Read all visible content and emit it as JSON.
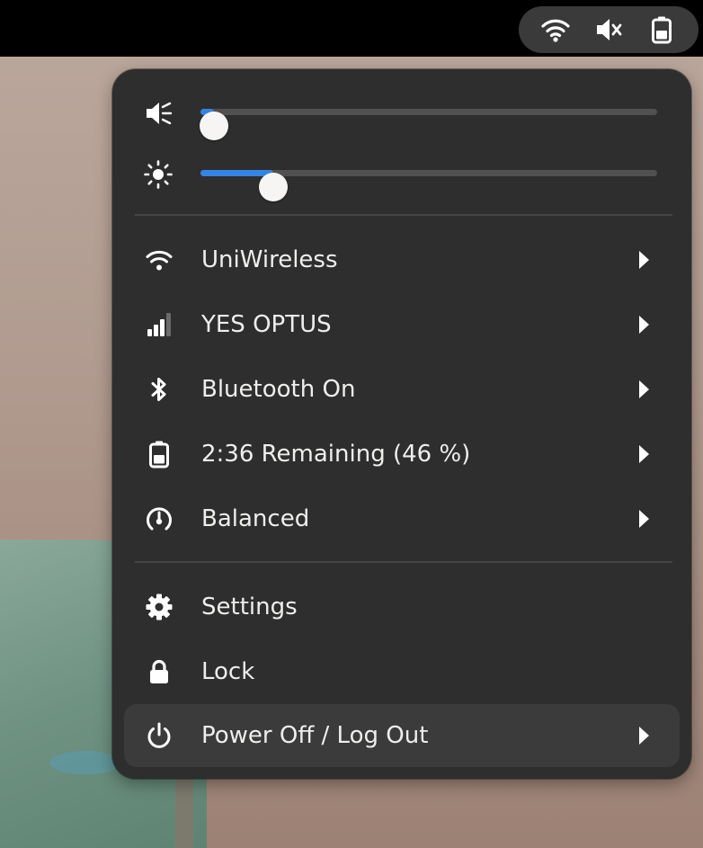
{
  "top_bar": {
    "tray": [
      "wifi-icon",
      "speaker-muted-icon",
      "battery-icon"
    ]
  },
  "sliders": {
    "volume": {
      "icon": "speaker-muted-icon",
      "level": 0.03
    },
    "brightness": {
      "icon": "brightness-icon",
      "level": 0.16
    }
  },
  "menu": {
    "items": [
      {
        "icon": "wifi-icon",
        "label": "UniWireless",
        "has_submenu": true
      },
      {
        "icon": "cellular-signal-icon",
        "label": "YES OPTUS",
        "has_submenu": true
      },
      {
        "icon": "bluetooth-icon",
        "label": "Bluetooth On",
        "has_submenu": true
      },
      {
        "icon": "battery-icon",
        "label": "2:36 Remaining (46 %)",
        "has_submenu": true
      },
      {
        "icon": "power-profile-icon",
        "label": "Balanced",
        "has_submenu": true
      },
      {
        "icon": "gear-icon",
        "label": "Settings",
        "has_submenu": false
      },
      {
        "icon": "lock-icon",
        "label": "Lock",
        "has_submenu": false
      },
      {
        "icon": "power-icon",
        "label": "Power Off / Log Out",
        "has_submenu": true
      }
    ]
  },
  "colors": {
    "accent": "#3584e4",
    "menu_bg": "#2e2e2e",
    "text": "#eeeeec"
  }
}
